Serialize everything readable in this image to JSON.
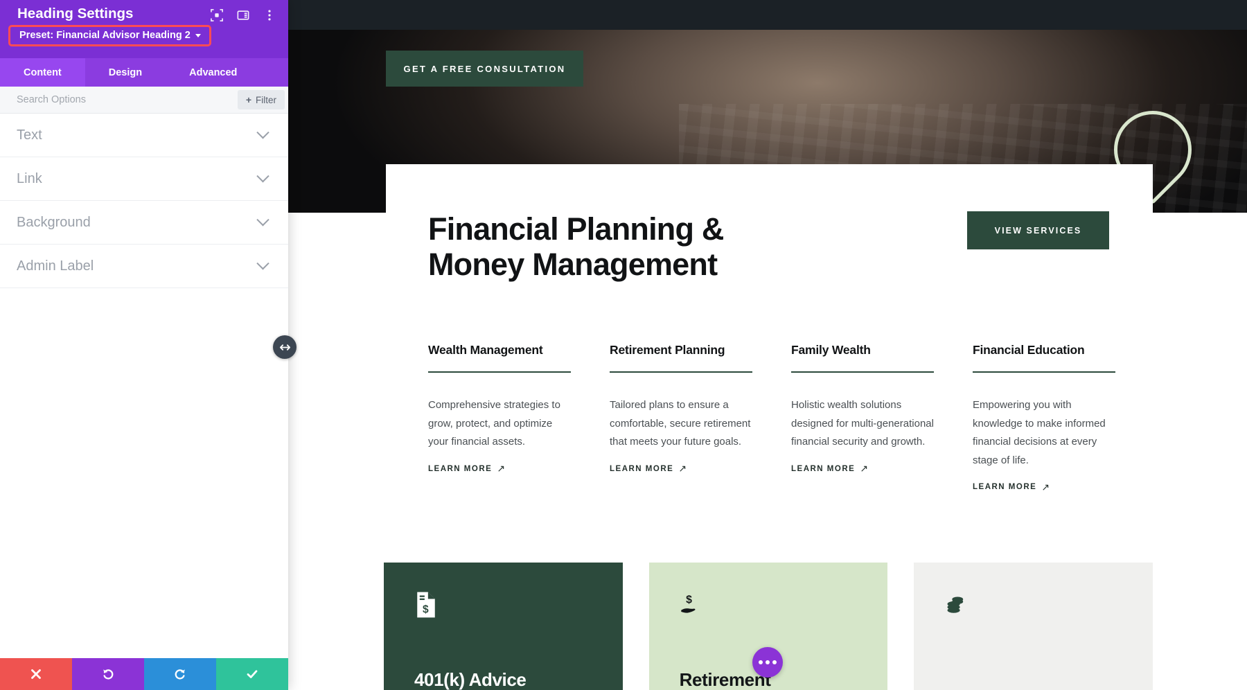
{
  "panel": {
    "title": "Heading Settings",
    "preset_label": "Preset: Financial Advisor Heading 2",
    "header_icons": [
      {
        "name": "focus-target-icon"
      },
      {
        "name": "layout-columns-icon"
      },
      {
        "name": "more-vertical-icon"
      }
    ],
    "tabs": [
      {
        "label": "Content",
        "active": true
      },
      {
        "label": "Design",
        "active": false
      },
      {
        "label": "Advanced",
        "active": false
      }
    ],
    "search": {
      "placeholder": "Search Options",
      "value": ""
    },
    "filter_button": {
      "label": "Filter",
      "icon": "plus-icon"
    },
    "sections": [
      {
        "label": "Text"
      },
      {
        "label": "Link"
      },
      {
        "label": "Background"
      },
      {
        "label": "Admin Label"
      }
    ],
    "footer_buttons": [
      {
        "name": "cancel",
        "icon": "close-icon",
        "color": "#ef5350"
      },
      {
        "name": "undo",
        "icon": "undo-icon",
        "color": "#8b33d6"
      },
      {
        "name": "redo",
        "icon": "redo-icon",
        "color": "#2b8fd9"
      },
      {
        "name": "save",
        "icon": "check-icon",
        "color": "#2fc39b"
      }
    ],
    "accent_purple": "#7b2fd4",
    "highlight_red": "#fd4b55"
  },
  "preview": {
    "hero_cta": "GET A FREE CONSULTATION",
    "headline": "Financial Planning & Money Management",
    "services_button": "VIEW SERVICES",
    "brand_green": "#2c4a3c",
    "mint": "#d6e6c9",
    "services": [
      {
        "title": "Wealth Management",
        "body": "Comprehensive strategies to grow, protect, and optimize your financial assets.",
        "link": "LEARN MORE"
      },
      {
        "title": "Retirement Planning",
        "body": "Tailored plans to ensure a comfortable, secure retirement that meets your future goals.",
        "link": "LEARN MORE"
      },
      {
        "title": "Family Wealth",
        "body": "Holistic wealth solutions designed for multi-generational financial security and growth.",
        "link": "LEARN MORE"
      },
      {
        "title": "Financial Education",
        "body": "Empowering you with knowledge to make informed financial decisions at every stage of life.",
        "link": "LEARN MORE"
      }
    ],
    "cards": [
      {
        "title": "401(k) Advice",
        "icon": "document-dollar-icon",
        "theme": "dark"
      },
      {
        "title": "Retirement",
        "icon": "hand-holding-dollar-icon",
        "theme": "mint"
      },
      {
        "title": "",
        "icon": "coins-stack-icon",
        "theme": "grey"
      }
    ],
    "fab": {
      "name": "options-fab",
      "icon": "ellipsis-icon",
      "color": "#8b33d6"
    }
  },
  "resize_handle": {
    "name": "panel-resize-handle",
    "icon": "arrows-horizontal-icon"
  }
}
